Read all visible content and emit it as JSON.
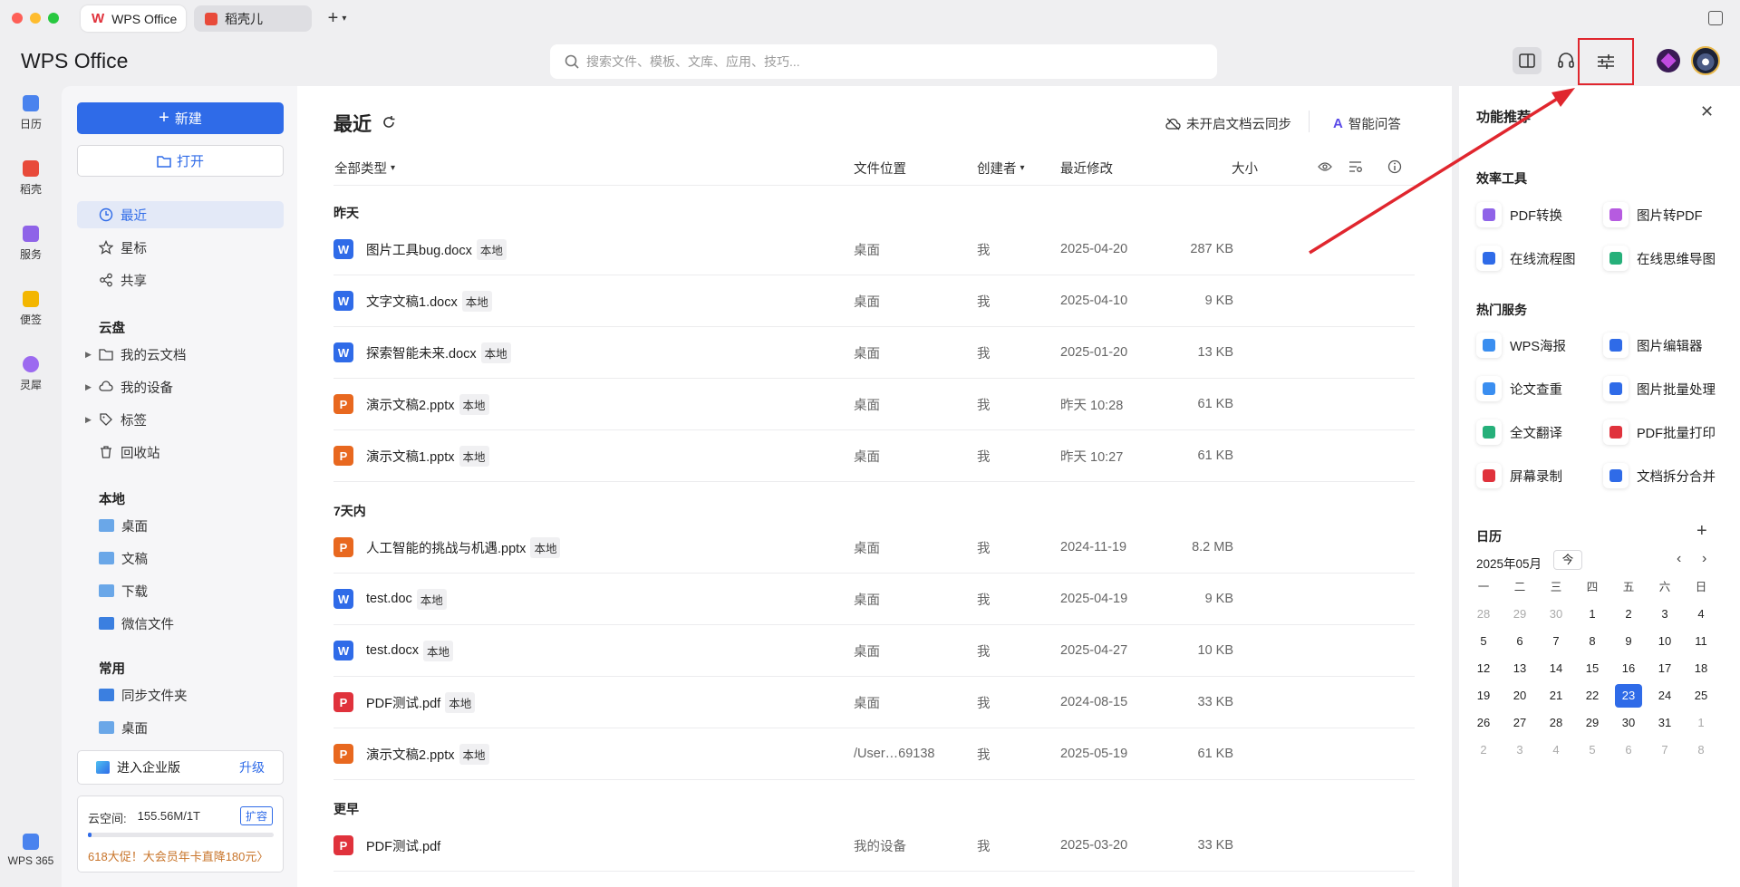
{
  "window": {
    "tabs": [
      {
        "label": "WPS Office"
      },
      {
        "label": "稻壳儿"
      }
    ],
    "new_tab": "+"
  },
  "header": {
    "logo": "WPS Office",
    "search_placeholder": "搜索文件、模板、文库、应用、技巧..."
  },
  "rail": {
    "items": [
      {
        "label": "日历",
        "color": "#4a83ee"
      },
      {
        "label": "稻壳",
        "color": "#e84a3a"
      },
      {
        "label": "服务",
        "color": "#8f63e8"
      },
      {
        "label": "便签",
        "color": "#f3b600"
      },
      {
        "label": "灵犀",
        "color": "#9c6af0"
      }
    ],
    "bottom_label": "WPS 365"
  },
  "sidebar": {
    "new_label": "新建",
    "open_label": "打开",
    "recent": "最近",
    "starred": "星标",
    "shared": "共享",
    "cloud_title": "云盘",
    "my_cloud": "我的云文档",
    "my_devices": "我的设备",
    "tags": "标签",
    "trash": "回收站",
    "local_title": "本地",
    "desktop": "桌面",
    "documents": "文稿",
    "downloads": "下载",
    "wechat": "微信文件",
    "common_title": "常用",
    "sync_folder": "同步文件夹",
    "desktop2": "桌面",
    "enterprise": "进入企业版",
    "upgrade": "升级",
    "cloud_space_label": "云空间:",
    "cloud_space_value": "155.56M/1T",
    "cloud_usage_fraction": 0.02,
    "expand": "扩容",
    "promo": "618大促！大会员年卡直降180元〉"
  },
  "main": {
    "title": "最近",
    "sync_status": "未开启文档云同步",
    "ai_qa": "智能问答",
    "columns": {
      "type": "全部类型",
      "location": "文件位置",
      "creator": "创建者",
      "modified": "最近修改",
      "size": "大小"
    },
    "groups": {
      "yesterday": "昨天",
      "week": "7天内",
      "earlier": "更早"
    },
    "local_badge": "本地",
    "files": [
      {
        "icon": "W",
        "color": "#2f6be8",
        "name": "图片工具bug.docx",
        "local": true,
        "location": "桌面",
        "creator": "我",
        "modified": "2025-04-20",
        "size": "287 KB"
      },
      {
        "icon": "W",
        "color": "#2f6be8",
        "name": "文字文稿1.docx",
        "local": true,
        "location": "桌面",
        "creator": "我",
        "modified": "2025-04-10",
        "size": "9 KB"
      },
      {
        "icon": "W",
        "color": "#2f6be8",
        "name": "探索智能未来.docx",
        "local": true,
        "location": "桌面",
        "creator": "我",
        "modified": "2025-01-20",
        "size": "13 KB"
      },
      {
        "icon": "P",
        "color": "#e8681f",
        "name": "演示文稿2.pptx",
        "local": true,
        "location": "桌面",
        "creator": "我",
        "modified": "昨天 10:28",
        "size": "61 KB"
      },
      {
        "icon": "P",
        "color": "#e8681f",
        "name": "演示文稿1.pptx",
        "local": true,
        "location": "桌面",
        "creator": "我",
        "modified": "昨天 10:27",
        "size": "61 KB"
      },
      {
        "icon": "P",
        "color": "#e8681f",
        "name": "人工智能的挑战与机遇.pptx",
        "local": true,
        "location": "桌面",
        "creator": "我",
        "modified": "2024-11-19",
        "size": "8.2 MB"
      },
      {
        "icon": "W",
        "color": "#2f6be8",
        "name": "test.doc",
        "local": true,
        "location": "桌面",
        "creator": "我",
        "modified": "2025-04-19",
        "size": "9 KB"
      },
      {
        "icon": "W",
        "color": "#2f6be8",
        "name": "test.docx",
        "local": true,
        "location": "桌面",
        "creator": "我",
        "modified": "2025-04-27",
        "size": "10 KB"
      },
      {
        "icon": "P",
        "color": "#e0323c",
        "name": "PDF测试.pdf",
        "local": true,
        "location": "桌面",
        "creator": "我",
        "modified": "2024-08-15",
        "size": "33 KB"
      },
      {
        "icon": "P",
        "color": "#e8681f",
        "name": "演示文稿2.pptx",
        "local": true,
        "location": "/User…69138",
        "creator": "我",
        "modified": "2025-05-19",
        "size": "61 KB"
      },
      {
        "icon": "P",
        "color": "#e0323c",
        "name": "PDF测试.pdf",
        "local": false,
        "location": "我的设备",
        "creator": "我",
        "modified": "2025-03-20",
        "size": "33 KB"
      }
    ]
  },
  "rpanel": {
    "title": "功能推荐",
    "efficiency_title": "效率工具",
    "efficiency": [
      {
        "label": "PDF转换",
        "color": "#8f63e8"
      },
      {
        "label": "图片转PDF",
        "color": "#b65be0"
      },
      {
        "label": "在线流程图",
        "color": "#2f6be8"
      },
      {
        "label": "在线思维导图",
        "color": "#26b07a"
      }
    ],
    "hot_title": "热门服务",
    "hot": [
      {
        "label": "WPS海报",
        "color": "#3a8ef0"
      },
      {
        "label": "图片编辑器",
        "color": "#2f6be8"
      },
      {
        "label": "论文查重",
        "color": "#3a8ef0"
      },
      {
        "label": "图片批量处理",
        "color": "#2f6be8"
      },
      {
        "label": "全文翻译",
        "color": "#26b07a"
      },
      {
        "label": "PDF批量打印",
        "color": "#e0323c"
      },
      {
        "label": "屏幕录制",
        "color": "#e0323c"
      },
      {
        "label": "文档拆分合并",
        "color": "#2f6be8"
      }
    ],
    "calendar_title": "日历",
    "month": "2025年05月",
    "today_btn": "今",
    "weekdays": [
      "一",
      "二",
      "三",
      "四",
      "五",
      "六",
      "日"
    ],
    "days": [
      "28",
      "29",
      "30",
      "1",
      "2",
      "3",
      "4",
      "5",
      "6",
      "7",
      "8",
      "9",
      "10",
      "11",
      "12",
      "13",
      "14",
      "15",
      "16",
      "17",
      "18",
      "19",
      "20",
      "21",
      "22",
      "23",
      "24",
      "25",
      "26",
      "27",
      "28",
      "29",
      "30",
      "31",
      "1",
      "2",
      "3",
      "4",
      "5",
      "6",
      "7",
      "8"
    ],
    "first_in_month": 3,
    "last_in_month": 33,
    "today_index": 25
  }
}
